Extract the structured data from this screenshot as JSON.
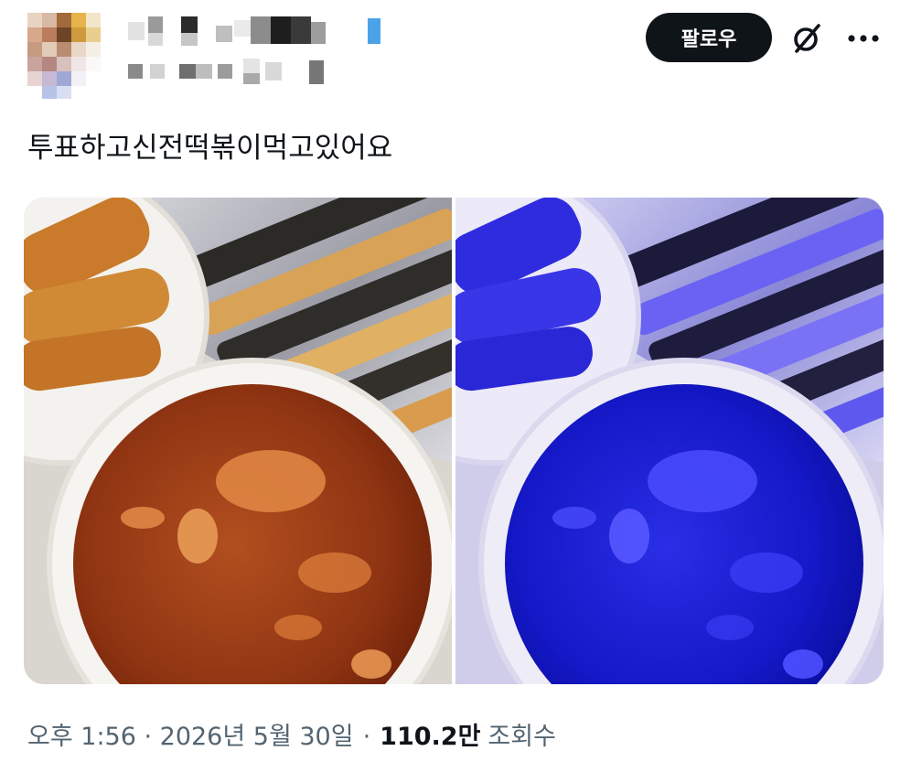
{
  "header": {
    "follow_label": "팔로우",
    "grok_icon": "grok-slash-icon",
    "more_icon": "more-dots-icon"
  },
  "tweet": {
    "text": "투표하고신전떡볶이먹고있어요"
  },
  "media": {
    "count": 2,
    "images": [
      {
        "description_icon": "food-photo",
        "tone": "normal"
      },
      {
        "description_icon": "food-photo",
        "tone": "blue-filtered"
      }
    ]
  },
  "meta": {
    "timestamp": "오후 1:56 · 2026년 5월 30일",
    "separator": "·",
    "views_count": "110.2만",
    "views_label": "조회수"
  },
  "colors": {
    "text_primary": "#0f1419",
    "text_secondary": "#536471",
    "follow_bg": "#0f1419",
    "follow_fg": "#ffffff"
  }
}
